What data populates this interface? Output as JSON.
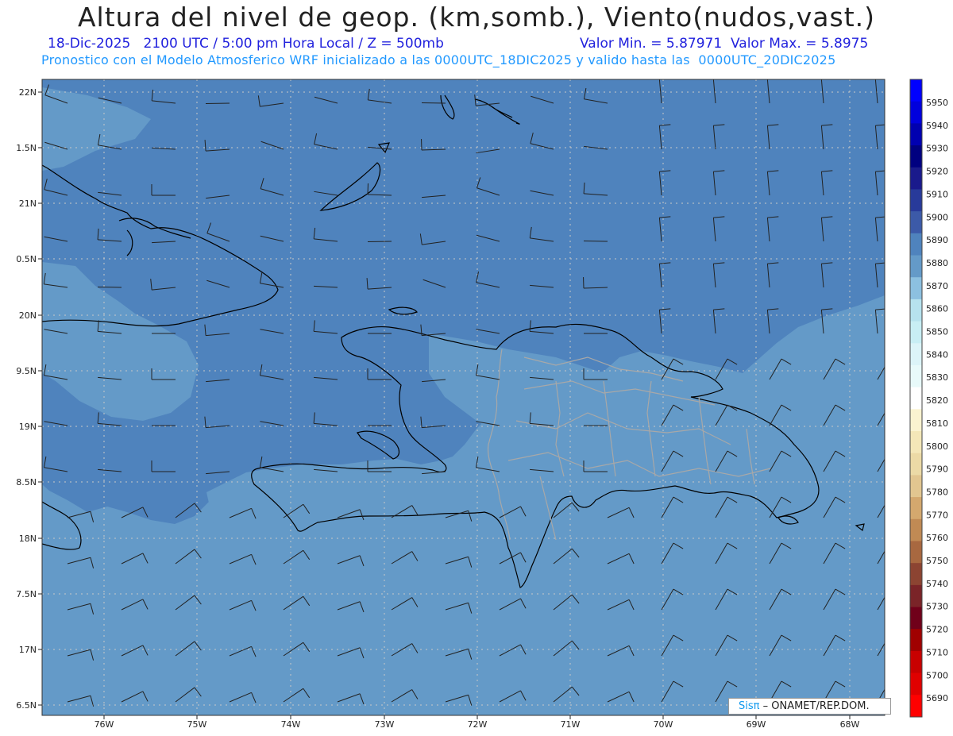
{
  "header": {
    "title": "Altura del nivel de geop. (km,somb.), Viento(nudos,vast.)",
    "subtitle_left": "18-Dic-2025   2100 UTC / 5:00 pm Hora Local / Z = 500mb",
    "subtitle_right": "Valor Min. = 5.87971  Valor Max. = 5.8975",
    "subtitle_model": "Pronostico con el Modelo Atmosferico WRF inicializado a las 0000UTC_18DIC2025 y valido hasta las  0000UTC_20DIC2025"
  },
  "map": {
    "lat_labels": [
      "22N",
      "1.5N",
      "21N",
      "0.5N",
      "20N",
      "9.5N",
      "19N",
      "8.5N",
      "18N",
      "7.5N",
      "17N",
      "6.5N"
    ],
    "lon_labels": [
      "76W",
      "75W",
      "74W",
      "73W",
      "72W",
      "71W",
      "70W",
      "69W",
      "68W"
    ],
    "colors": {
      "field_5880": "#649ac8",
      "field_5890": "#4f83bd",
      "coast": "#000000",
      "provinces": "#a8a8a8",
      "grid": "#c8c8c8"
    }
  },
  "colorbar": {
    "levels": [
      "5950",
      "5940",
      "5930",
      "5920",
      "5910",
      "5900",
      "5890",
      "5880",
      "5870",
      "5860",
      "5850",
      "5840",
      "5830",
      "5820",
      "5810",
      "5800",
      "5790",
      "5780",
      "5770",
      "5760",
      "5750",
      "5740",
      "5730",
      "5720",
      "5710",
      "5700",
      "5690"
    ],
    "colors": [
      "#0000ff",
      "#0000dd",
      "#0000b0",
      "#000080",
      "#1a1a8c",
      "#283a9a",
      "#3c5aa8",
      "#4f83bd",
      "#649ac8",
      "#8cc0e0",
      "#b6e2ee",
      "#c8eef4",
      "#dcf4f8",
      "#e8fafa",
      "#ffffff",
      "#fbf3d0",
      "#f4e7b8",
      "#ecdaa6",
      "#e2c690",
      "#d4a86e",
      "#c08a54",
      "#a86840",
      "#8c4432",
      "#7a2428",
      "#70001a",
      "#a00000",
      "#c80000",
      "#e00000",
      "#ff0000"
    ]
  },
  "credit": {
    "sis": "Sisπ",
    "text": "– ONAMET/REP.DOM."
  }
}
